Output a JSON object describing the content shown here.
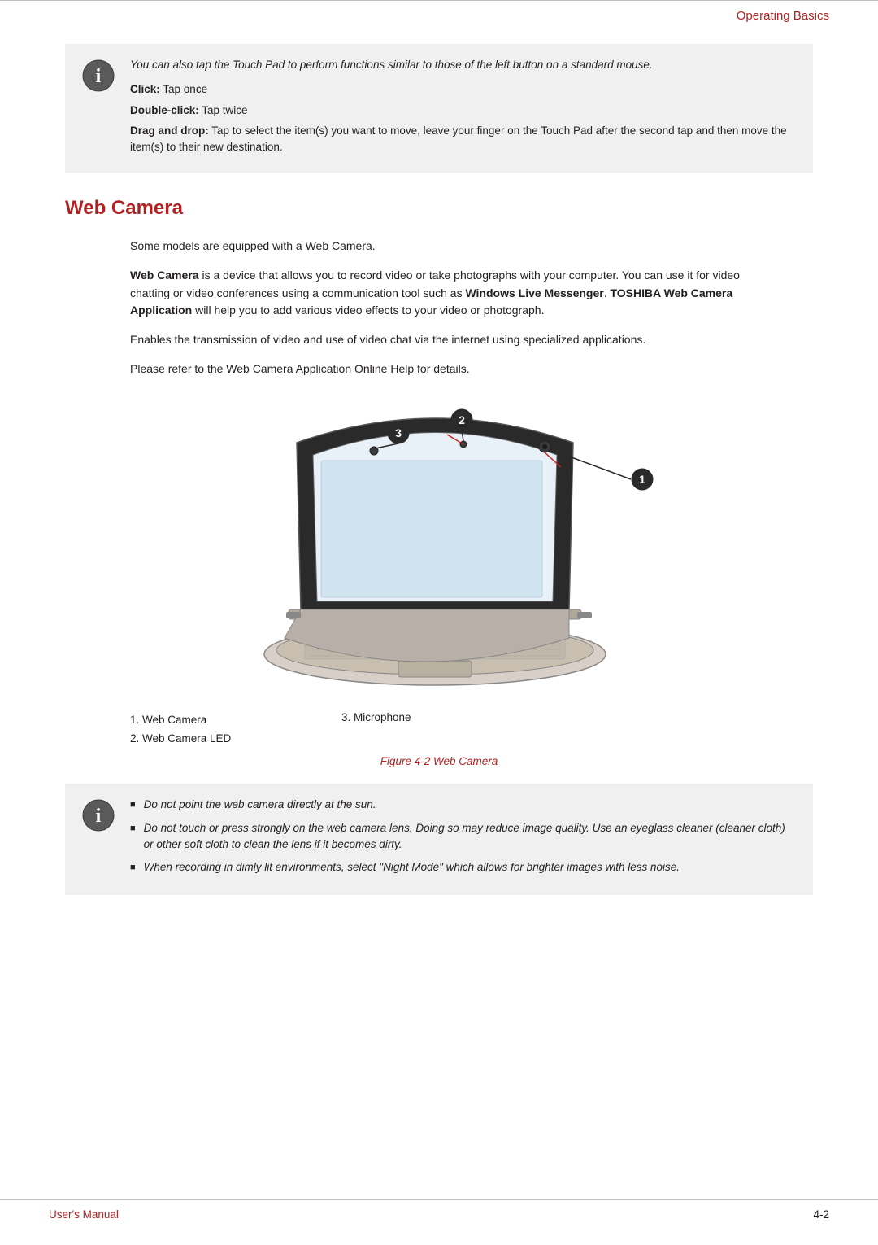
{
  "header": {
    "title": "Operating Basics"
  },
  "info_box1": {
    "intro": "You can also tap the Touch Pad to perform functions similar to those of the left button on a standard mouse.",
    "click_label": "Click:",
    "click_value": "Tap once",
    "double_click_label": "Double-click:",
    "double_click_value": "Tap twice",
    "drag_label": "Drag and drop:",
    "drag_value": "Tap to select the item(s) you want to move, leave your finger on the Touch Pad after the second tap and then move the item(s) to their new destination."
  },
  "section": {
    "heading": "Web Camera",
    "para1": "Some models are equipped with a Web Camera.",
    "para2_start": "",
    "para2": "Web Camera is a device that allows you to record video or take photographs with your computer. You can use it for video chatting or video conferences using a communication tool such as Windows Live Messenger. TOSHIBA Web Camera Application will help you to add various video effects to your video or photograph.",
    "para3": "Enables the transmission of video and use of video chat via the internet using specialized applications.",
    "para4": "Please refer to the Web Camera Application Online Help for details."
  },
  "diagram": {
    "label1": "1. Web Camera",
    "label2": "2. Web Camera LED",
    "label3": "3. Microphone",
    "caption": "Figure 4-2 Web Camera"
  },
  "info_box2": {
    "bullet1": "Do not point the web camera directly at the sun.",
    "bullet2": "Do not touch or press strongly on the web camera lens. Doing so may reduce image quality. Use an eyeglass cleaner (cleaner cloth) or other soft cloth to clean the lens if it becomes dirty.",
    "bullet3": "When recording in dimly lit environments, select \"Night Mode\" which allows for brighter images with less noise."
  },
  "footer": {
    "left": "User's Manual",
    "right": "4-2"
  }
}
